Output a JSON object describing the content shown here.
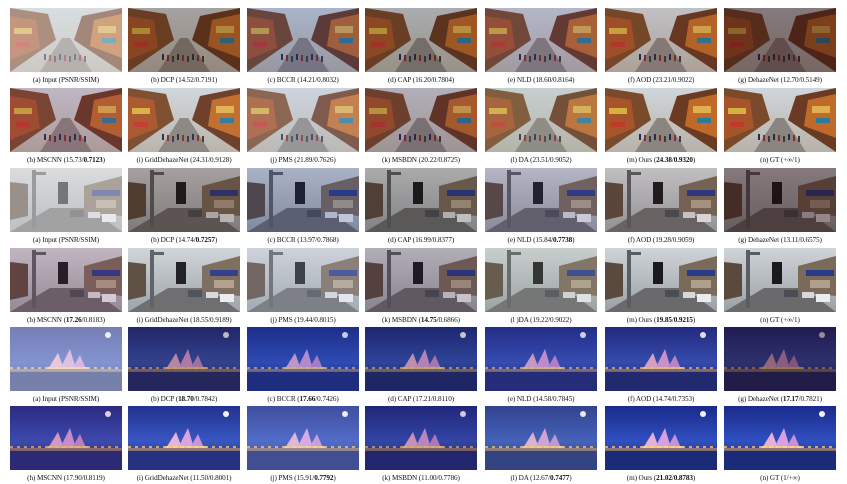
{
  "figure": {
    "rows": [
      {
        "scene": "street",
        "captions": [
          {
            "pre": "(a) Input (PSNR/SSIM)",
            "psnr": "",
            "ssim": "",
            "bold_psnr": false,
            "bold_ssim": false,
            "method": "input"
          },
          {
            "pre": "(b) DCP",
            "psnr": "14.52",
            "ssim": "0.7191",
            "bold_psnr": false,
            "bold_ssim": false,
            "method": "dcp"
          },
          {
            "pre": "(c) BCCR",
            "psnr": "14.21",
            "ssim": "0.8032",
            "bold_psnr": false,
            "bold_ssim": false,
            "method": "bccr"
          },
          {
            "pre": "(d) CAP",
            "psnr": "16.20",
            "ssim": "0.7804",
            "bold_psnr": false,
            "bold_ssim": false,
            "method": "cap"
          },
          {
            "pre": "(e) NLD",
            "psnr": "18.60",
            "ssim": "0.8164",
            "bold_psnr": false,
            "bold_ssim": false,
            "method": "nld"
          },
          {
            "pre": "(f) AOD",
            "psnr": "23.21",
            "ssim": "0.9022",
            "bold_psnr": false,
            "bold_ssim": false,
            "method": "aod"
          },
          {
            "pre": "(g) DehazeNet",
            "psnr": "12.70",
            "ssim": "0.5149",
            "bold_psnr": false,
            "bold_ssim": false,
            "method": "dehazenet"
          }
        ]
      },
      {
        "scene": "street",
        "captions": [
          {
            "pre": "(h) MSCNN",
            "psnr": "15.73",
            "ssim": "0.7123",
            "bold_psnr": false,
            "bold_ssim": true,
            "method": "mscnn"
          },
          {
            "pre": "(i) GridDehazeNet",
            "psnr": "24.31",
            "ssim": "0.9128",
            "bold_psnr": false,
            "bold_ssim": false,
            "method": "grid"
          },
          {
            "pre": "(j) PMS",
            "psnr": "21.89",
            "ssim": "0.7626",
            "bold_psnr": false,
            "bold_ssim": false,
            "method": "pms"
          },
          {
            "pre": "(k) MSBDN",
            "psnr": "20.22",
            "ssim": "0.8725",
            "bold_psnr": false,
            "bold_ssim": false,
            "method": "msbdn"
          },
          {
            "pre": "(l) DA",
            "psnr": "23.51",
            "ssim": "0.9052",
            "bold_psnr": false,
            "bold_ssim": false,
            "method": "da"
          },
          {
            "pre": "(m) Ours",
            "psnr": "24.38",
            "ssim": "0.9320",
            "bold_psnr": true,
            "bold_ssim": true,
            "method": "ours"
          },
          {
            "pre": "(n) GT (+∞/1)",
            "psnr": "",
            "ssim": "",
            "bold_psnr": false,
            "bold_ssim": false,
            "method": "gt"
          }
        ]
      },
      {
        "scene": "road",
        "captions": [
          {
            "pre": "(a) Input (PSNR/SSIM)",
            "psnr": "",
            "ssim": "",
            "bold_psnr": false,
            "bold_ssim": false,
            "method": "input"
          },
          {
            "pre": "(b) DCP",
            "psnr": "14.74",
            "ssim": "0.7257",
            "bold_psnr": false,
            "bold_ssim": true,
            "method": "dcp"
          },
          {
            "pre": "(c) BCCR",
            "psnr": "13.97",
            "ssim": "0.7868",
            "bold_psnr": false,
            "bold_ssim": false,
            "method": "bccr"
          },
          {
            "pre": "(d) CAP",
            "psnr": "16.99",
            "ssim": "0.8377",
            "bold_psnr": false,
            "bold_ssim": false,
            "method": "cap"
          },
          {
            "pre": "(e) NLD",
            "psnr": "15.84",
            "ssim": "0.7738",
            "bold_psnr": false,
            "bold_ssim": true,
            "method": "nld"
          },
          {
            "pre": "(f) AOD",
            "psnr": "19.28",
            "ssim": "0.9059",
            "bold_psnr": false,
            "bold_ssim": false,
            "method": "aod"
          },
          {
            "pre": "(g) DehazeNet",
            "psnr": "13.11",
            "ssim": "0.6575",
            "bold_psnr": false,
            "bold_ssim": false,
            "method": "dehazenet"
          }
        ]
      },
      {
        "scene": "road",
        "captions": [
          {
            "pre": "(h) MSCNN",
            "psnr": "17.26",
            "ssim": "0.8183",
            "bold_psnr": true,
            "bold_ssim": false,
            "method": "mscnn"
          },
          {
            "pre": "(i) GridDehazeNet",
            "psnr": "18.55",
            "ssim": "0.9189",
            "bold_psnr": false,
            "bold_ssim": false,
            "method": "grid"
          },
          {
            "pre": "(j) PMS",
            "psnr": "19.44",
            "ssim": "0.8015",
            "bold_psnr": false,
            "bold_ssim": false,
            "method": "pms"
          },
          {
            "pre": "(k) MSBDN",
            "psnr": "14.75",
            "ssim": "0.6866",
            "bold_psnr": true,
            "bold_ssim": false,
            "method": "msbdn"
          },
          {
            "pre": "(l )DA",
            "psnr": "19.22",
            "ssim": "0.9022",
            "bold_psnr": false,
            "bold_ssim": false,
            "method": "da"
          },
          {
            "pre": "(m) Ours",
            "psnr": "19.85",
            "ssim": "0.9215",
            "bold_psnr": true,
            "bold_ssim": true,
            "method": "ours"
          },
          {
            "pre": "(n) GT (+∞/1)",
            "psnr": "",
            "ssim": "",
            "bold_psnr": false,
            "bold_ssim": false,
            "method": "gt"
          }
        ]
      },
      {
        "scene": "opera",
        "captions": [
          {
            "pre": "(a) Input (PSNR/SSIM)",
            "psnr": "",
            "ssim": "",
            "bold_psnr": false,
            "bold_ssim": false,
            "method": "input"
          },
          {
            "pre": "(b) DCP",
            "psnr": "18.70",
            "ssim": "0.7842",
            "bold_psnr": true,
            "bold_ssim": false,
            "method": "dcp"
          },
          {
            "pre": "(c) BCCR",
            "psnr": "17.66",
            "ssim": "0.7426",
            "bold_psnr": true,
            "bold_ssim": false,
            "method": "bccr"
          },
          {
            "pre": "(d) CAP",
            "psnr": "17.21",
            "ssim": "0.8110",
            "bold_psnr": false,
            "bold_ssim": false,
            "method": "cap"
          },
          {
            "pre": "(e) NLD",
            "psnr": "14.58",
            "ssim": "0.7845",
            "bold_psnr": false,
            "bold_ssim": false,
            "method": "nld"
          },
          {
            "pre": "(f) AOD",
            "psnr": "14.74",
            "ssim": "0.7353",
            "bold_psnr": false,
            "bold_ssim": false,
            "method": "aod"
          },
          {
            "pre": "(g) DehazeNet",
            "psnr": "17.17",
            "ssim": "0.7821",
            "bold_psnr": true,
            "bold_ssim": false,
            "method": "dehazenet"
          }
        ]
      },
      {
        "scene": "opera",
        "captions": [
          {
            "pre": "(h) MSCNN",
            "psnr": "17.90",
            "ssim": "0.8119",
            "bold_psnr": false,
            "bold_ssim": false,
            "method": "mscnn"
          },
          {
            "pre": "(i) GridDehazeNet",
            "psnr": "11.50",
            "ssim": "0.8001",
            "bold_psnr": false,
            "bold_ssim": false,
            "method": "grid"
          },
          {
            "pre": "(j) PMS",
            "psnr": "15.91",
            "ssim": "0.7792",
            "bold_psnr": false,
            "bold_ssim": true,
            "method": "pms"
          },
          {
            "pre": "(k) MSBDN",
            "psnr": "11.00",
            "ssim": "0.7786",
            "bold_psnr": false,
            "bold_ssim": false,
            "method": "msbdn"
          },
          {
            "pre": "(l) DA",
            "psnr": "12.67",
            "ssim": "0.7477",
            "bold_psnr": false,
            "bold_ssim": true,
            "method": "da"
          },
          {
            "pre": "(m) Ours",
            "psnr": "21.02",
            "ssim": "0.8783",
            "bold_psnr": true,
            "bold_ssim": true,
            "method": "ours"
          },
          {
            "pre": "(n) GT (1/+∞)",
            "psnr": "",
            "ssim": "",
            "bold_psnr": false,
            "bold_ssim": false,
            "method": "gt"
          }
        ]
      }
    ],
    "method_tints": {
      "input": {
        "overlay": "#e6e6e6",
        "opacity": 0.45
      },
      "dcp": {
        "overlay": "#3a1c10",
        "opacity": 0.28
      },
      "bccr": {
        "overlay": "#2a3a8a",
        "opacity": 0.22
      },
      "cap": {
        "overlay": "#2a1a12",
        "opacity": 0.22
      },
      "nld": {
        "overlay": "#4a3a7a",
        "opacity": 0.2
      },
      "aod": {
        "overlay": "#5a2a20",
        "opacity": 0.12
      },
      "dehazenet": {
        "overlay": "#2a0a0a",
        "opacity": 0.45
      },
      "mscnn": {
        "overlay": "#7a2a5a",
        "opacity": 0.18
      },
      "grid": {
        "overlay": "#ffffff",
        "opacity": 0.04
      },
      "pms": {
        "overlay": "#c8d0e8",
        "opacity": 0.22
      },
      "msbdn": {
        "overlay": "#3a1a3a",
        "opacity": 0.2
      },
      "da": {
        "overlay": "#a8b8a0",
        "opacity": 0.18
      },
      "ours": {
        "overlay": "#ffffff",
        "opacity": 0.0
      },
      "gt": {
        "overlay": "#ffffff",
        "opacity": 0.0
      }
    }
  }
}
